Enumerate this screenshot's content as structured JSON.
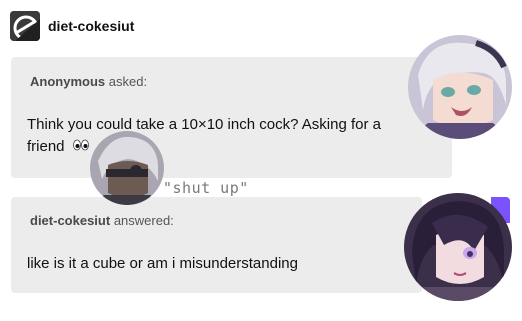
{
  "header": {
    "blog_name": "diet-cokesiut"
  },
  "ask": {
    "asker": "Anonymous",
    "asked_label": "asked:",
    "question": "Think you could take a 10×10 inch cock? Asking for a friend"
  },
  "answer": {
    "answerer": "diet-cokesiut",
    "answered_label": "answered:",
    "text": "like is it a cube or am i misunderstanding"
  },
  "overlay": {
    "caption": "\"shut up\""
  },
  "colors": {
    "bubble": "#ececec",
    "accent": "#7b52ff",
    "text": "#111111"
  },
  "icons": {
    "blog_avatar": "blog-logo-icon",
    "eyes_emoji": "eyes-emoji-icon"
  }
}
